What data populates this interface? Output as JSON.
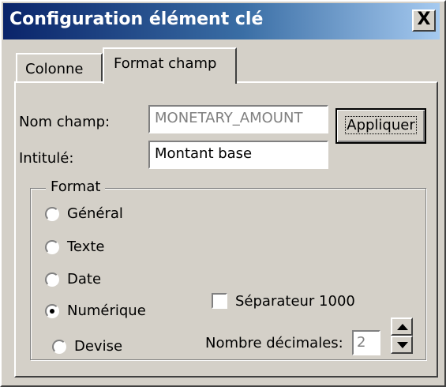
{
  "window": {
    "title": "Configuration élément clé",
    "close_label": "X"
  },
  "tabs": [
    {
      "label": "Colonne",
      "active": false
    },
    {
      "label": "Format champ",
      "active": true
    }
  ],
  "fields": {
    "nom_champ_label": "Nom champ:",
    "nom_champ_value": "MONETARY_AMOUNT",
    "intitule_label": "Intitulé:",
    "intitule_value": "Montant base"
  },
  "apply_button": "Appliquer",
  "format_group": {
    "legend": "Format",
    "options": [
      {
        "label": "Général",
        "selected": false
      },
      {
        "label": "Texte",
        "selected": false
      },
      {
        "label": "Date",
        "selected": false
      },
      {
        "label": "Numérique",
        "selected": true
      },
      {
        "label": "Devise",
        "selected": false
      }
    ],
    "separator_label": "Séparateur 1000",
    "separator_checked": false,
    "decimals_label": "Nombre décimales:",
    "decimals_value": "2"
  },
  "colors": {
    "face": "#d4d0c8",
    "title_start": "#0a246a",
    "title_end": "#a6caf0",
    "disabled_text": "#808080"
  }
}
